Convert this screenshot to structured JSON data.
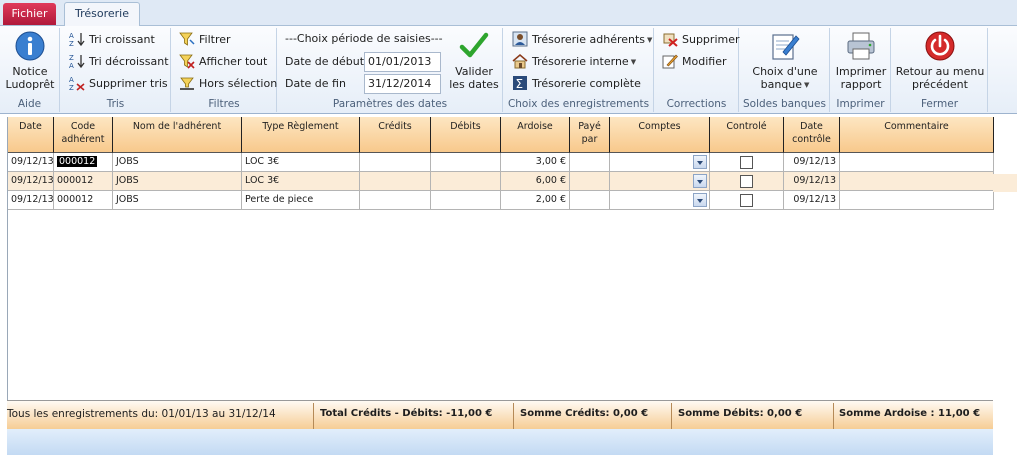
{
  "tabs": {
    "file": "Fichier",
    "active": "Trésorerie"
  },
  "ribbon": {
    "aide": {
      "label": "Aide",
      "notice": "Notice Ludoprêt"
    },
    "tris": {
      "label": "Tris",
      "asc": "Tri croissant",
      "desc": "Tri décroissant",
      "remove": "Supprimer tris"
    },
    "filtres": {
      "label": "Filtres",
      "filter": "Filtrer",
      "show_all": "Afficher tout",
      "out_selection": "Hors sélection"
    },
    "periode": {
      "label": "Paramètres des dates",
      "title": "---Choix période de saisies---",
      "start_label": "Date de début",
      "start_value": "01/01/2013",
      "end_label": "Date de fin",
      "end_value": "31/12/2014",
      "validate": "Valider les dates"
    },
    "choix": {
      "label": "Choix des enregistrements",
      "adherents": "Trésorerie adhérents",
      "interne": "Trésorerie interne",
      "complete": "Trésorerie complète"
    },
    "corrections": {
      "label": "Corrections",
      "delete": "Supprimer",
      "edit": "Modifier"
    },
    "soldes": {
      "label": "Soldes banques",
      "choose_bank": "Choix d'une banque"
    },
    "imprimer": {
      "label": "Imprimer",
      "print": "Imprimer rapport"
    },
    "fermer": {
      "label": "Fermer",
      "back": "Retour au menu précédent"
    }
  },
  "columns": [
    "Date",
    "Code adhérent",
    "Nom de l'adhérent",
    "Type Règlement",
    "Crédits",
    "Débits",
    "Ardoise",
    "Payé par",
    "Comptes",
    "Controlé",
    "Date contrôle",
    "Commentaire"
  ],
  "rows": [
    {
      "date": "09/12/13",
      "code": "000012",
      "name": "JOBS",
      "type": "LOC 3€",
      "credit": "",
      "debit": "",
      "ardoise": "3,00 €",
      "paid_by": "",
      "comptes": "",
      "controle": false,
      "date_controle": "09/12/13",
      "comment": ""
    },
    {
      "date": "09/12/13",
      "code": "000012",
      "name": "JOBS",
      "type": "LOC 3€",
      "credit": "",
      "debit": "",
      "ardoise": "6,00 €",
      "paid_by": "",
      "comptes": "",
      "controle": false,
      "date_controle": "09/12/13",
      "comment": ""
    },
    {
      "date": "09/12/13",
      "code": "000012",
      "name": "JOBS",
      "type": "Perte de piece",
      "credit": "",
      "debit": "",
      "ardoise": "2,00 €",
      "paid_by": "",
      "comptes": "",
      "controle": false,
      "date_controle": "09/12/13",
      "comment": ""
    }
  ],
  "footer": {
    "range": "Tous les enregistrements du: 01/01/13 au 31/12/14",
    "total": "Total Crédits - Débits: -11,00 €",
    "credits": "Somme Crédits: 0,00 €",
    "debits": "Somme Débits:  0,00 €",
    "ardoise": "Somme Ardoise : 11,00 €"
  },
  "colors": {
    "file_tab": "#c8203f",
    "header_orange": "#f8c98c",
    "ribbon_bg": "#e6eef8",
    "footer_blue": "#c3daf3"
  }
}
